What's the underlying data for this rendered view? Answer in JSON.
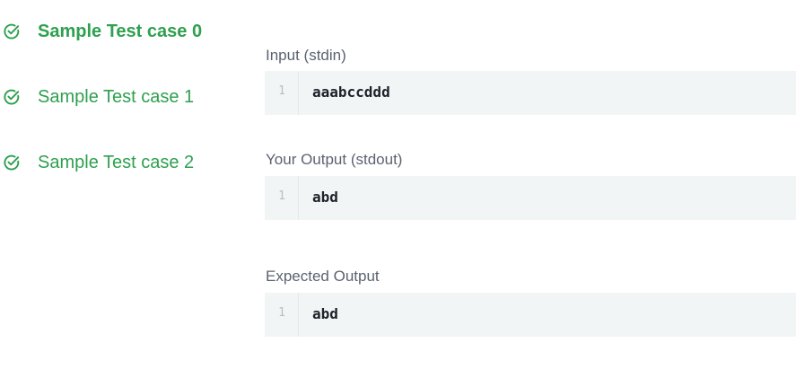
{
  "test_cases": [
    {
      "label": "Sample Test case 0",
      "status": "passed",
      "icon": "check-circle-icon"
    },
    {
      "label": "Sample Test case 1",
      "status": "passed",
      "icon": "check-circle-icon"
    },
    {
      "label": "Sample Test case 2",
      "status": "passed",
      "icon": "check-circle-icon"
    }
  ],
  "io": {
    "input": {
      "title": "Input (stdin)",
      "line_number": "1",
      "content": "aaabccddd"
    },
    "output": {
      "title": "Your Output (stdout)",
      "line_number": "1",
      "content": "abd"
    },
    "expected": {
      "title": "Expected Output",
      "line_number": "1",
      "content": "abd"
    }
  },
  "colors": {
    "success_green": "#2ea04f",
    "code_background": "#f2f5f6",
    "title_gray": "#5b6370"
  }
}
